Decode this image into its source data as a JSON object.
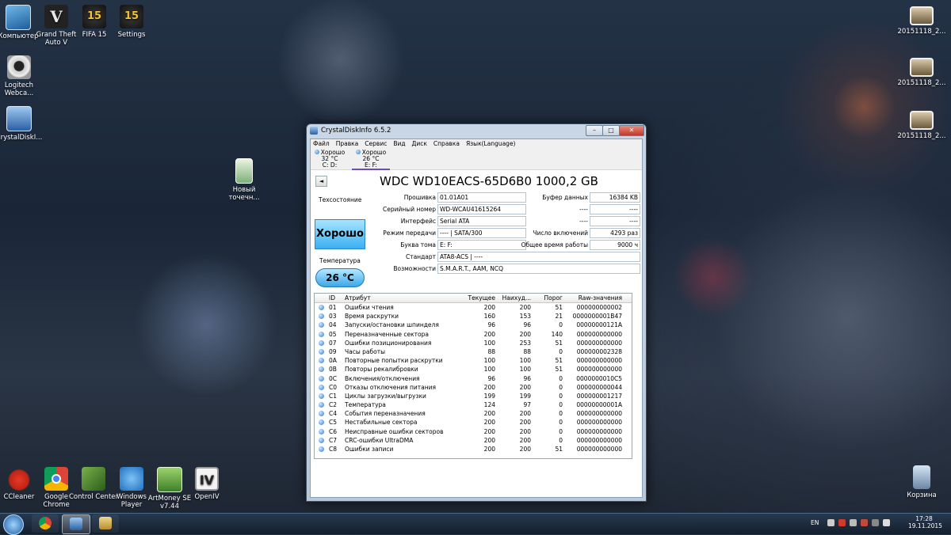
{
  "desktop": {
    "left_icons": [
      {
        "label": "Компьютер",
        "icon": "computer-icon"
      },
      {
        "label": "Grand Theft Auto V",
        "icon": "gta-icon",
        "glyph": "V"
      },
      {
        "label": "FIFA 15",
        "icon": "fifa-icon",
        "glyph": "15"
      },
      {
        "label": "Settings",
        "icon": "settings-icon",
        "glyph": "15"
      },
      {
        "label": "Logitech Webca...",
        "icon": "webcam-icon"
      },
      {
        "label": "CrystalDiskI...",
        "icon": "crystaldisk-icon"
      },
      {
        "label": "Новый точечн...",
        "icon": "notepad-icon"
      }
    ],
    "bottom_icons": [
      {
        "label": "CCleaner",
        "icon": "ccleaner-icon"
      },
      {
        "label": "Google Chrome",
        "icon": "chrome-icon"
      },
      {
        "label": "Control Center",
        "icon": "control-center-icon"
      },
      {
        "label": "Windows Player",
        "icon": "windows-player-icon"
      },
      {
        "label": "ArtMoney SE v7.44",
        "icon": "artmoney-icon"
      },
      {
        "label": "OpenIV",
        "icon": "openiv-icon",
        "glyph": "IV"
      }
    ],
    "right_icons": [
      {
        "label": "20151118_2...",
        "icon": "image-file-icon"
      },
      {
        "label": "20151118_2...",
        "icon": "image-file-icon"
      },
      {
        "label": "20151118_2...",
        "icon": "image-file-icon"
      },
      {
        "label": "Корзина",
        "icon": "recycle-bin-icon"
      }
    ]
  },
  "window": {
    "title": "CrystalDiskInfo 6.5.2",
    "min": "–",
    "max": "□",
    "close": "✕",
    "menu": [
      "Файл",
      "Правка",
      "Сервис",
      "Вид",
      "Диск",
      "Справка",
      "Язык(Language)"
    ],
    "disks": [
      {
        "status": "Хорошо",
        "temp": "32 °C",
        "letters": "C: D:"
      },
      {
        "status": "Хорошо",
        "temp": "26 °C",
        "letters": "E: F:"
      }
    ],
    "nav": "◄",
    "model": "WDC WD10EACS-65D6B0 1000,2 GB",
    "health_label": "Техсостояние",
    "health": "Хорошо",
    "temp_label": "Температура",
    "temp": "26 °C",
    "info_left": [
      {
        "label": "Прошивка",
        "value": "01.01A01"
      },
      {
        "label": "Серийный номер",
        "value": "WD-WCAU41615264"
      },
      {
        "label": "Интерфейс",
        "value": "Serial ATA"
      },
      {
        "label": "Режим передачи",
        "value": "---- | SATA/300"
      },
      {
        "label": "Буква тома",
        "value": "E: F:"
      }
    ],
    "info_right": [
      {
        "label": "Буфер данных",
        "value": "16384 KB"
      },
      {
        "label": "----",
        "value": "----"
      },
      {
        "label": "----",
        "value": "----"
      },
      {
        "label": "Число включений",
        "value": "4293 раз"
      },
      {
        "label": "Общее время работы",
        "value": "9000 ч"
      }
    ],
    "standard_label": "Стандарт",
    "standard": "ATA8-ACS | ----",
    "features_label": "Возможности",
    "features": "S.M.A.R.T., AAM, NCQ",
    "smart_headers": [
      "",
      "ID",
      "Атрибут",
      "Текущее",
      "Наихуд...",
      "Порог",
      "Raw-значения"
    ],
    "smart_rows": [
      [
        "01",
        "Ошибки чтения",
        "200",
        "200",
        "51",
        "000000000002"
      ],
      [
        "03",
        "Время раскрутки",
        "160",
        "153",
        "21",
        "0000000001B47"
      ],
      [
        "04",
        "Запуски/остановки шпинделя",
        "96",
        "96",
        "0",
        "00000000121A"
      ],
      [
        "05",
        "Переназначенные сектора",
        "200",
        "200",
        "140",
        "000000000000"
      ],
      [
        "07",
        "Ошибки позиционирования",
        "100",
        "253",
        "51",
        "000000000000"
      ],
      [
        "09",
        "Часы работы",
        "88",
        "88",
        "0",
        "000000002328"
      ],
      [
        "0A",
        "Повторные попытки раскрутки",
        "100",
        "100",
        "51",
        "000000000000"
      ],
      [
        "0B",
        "Повторы рекалибровки",
        "100",
        "100",
        "51",
        "000000000000"
      ],
      [
        "0C",
        "Включения/отключения",
        "96",
        "96",
        "0",
        "0000000010C5"
      ],
      [
        "C0",
        "Отказы отключения питания",
        "200",
        "200",
        "0",
        "000000000044"
      ],
      [
        "C1",
        "Циклы загрузки/выгрузки",
        "199",
        "199",
        "0",
        "000000001217"
      ],
      [
        "C2",
        "Температура",
        "124",
        "97",
        "0",
        "00000000001A"
      ],
      [
        "C4",
        "События переназначения",
        "200",
        "200",
        "0",
        "000000000000"
      ],
      [
        "C5",
        "Нестабильные сектора",
        "200",
        "200",
        "0",
        "000000000000"
      ],
      [
        "C6",
        "Неисправные ошибки секторов",
        "200",
        "200",
        "0",
        "000000000000"
      ],
      [
        "C7",
        "CRC-ошибки UltraDMA",
        "200",
        "200",
        "0",
        "000000000000"
      ],
      [
        "C8",
        "Ошибки записи",
        "200",
        "200",
        "51",
        "000000000000"
      ]
    ]
  },
  "taskbar": {
    "lang": "EN",
    "time": "17:28",
    "date": "19.11.2015"
  }
}
